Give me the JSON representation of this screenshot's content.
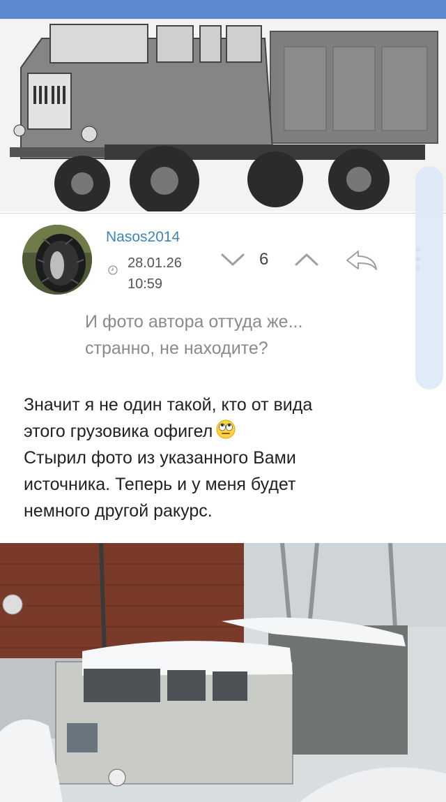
{
  "comment": {
    "username": "Nasos2014",
    "date": "28.01.26",
    "time": "10:59",
    "rating": "6",
    "quote_lines": [
      "И фото автора оттуда же...",
      "странно, не находите?"
    ],
    "body_lines": [
      "Значит я не один такой, кто от вида",
      "этого грузовика офигел",
      "Стырил фото из указанного Вами",
      "источника. Теперь и у меня будет",
      "немного другой ракурс."
    ]
  },
  "icons": {
    "avatar": "tire-photo",
    "clock": "clock-icon",
    "vote_down": "chevron-down-icon",
    "vote_up": "chevron-up-icon",
    "reply": "reply-arrow-icon",
    "more": "more-vertical-icon",
    "emoji": "eye-roll-emoji"
  },
  "colors": {
    "topbar": "#5b88cf",
    "username": "#3a87b7",
    "quote_text": "#8a8a8a",
    "body_text": "#222222"
  }
}
